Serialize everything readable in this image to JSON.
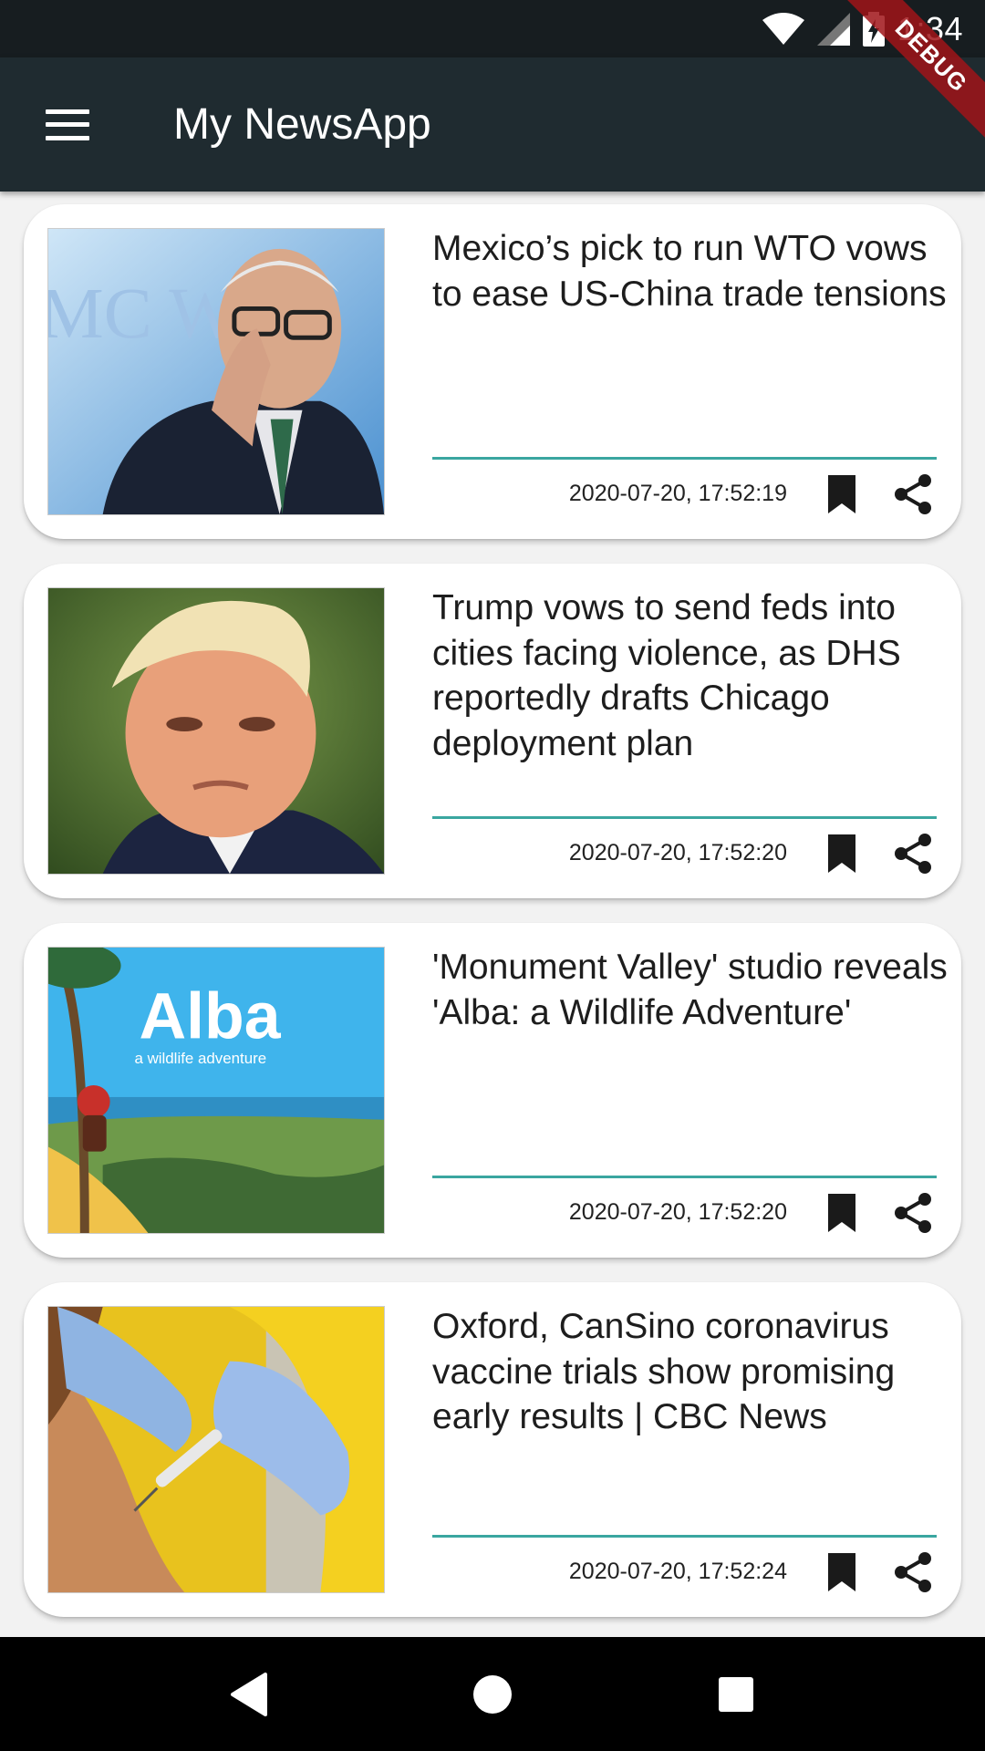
{
  "status_bar": {
    "time": "1:34",
    "debug_label": "DEBUG"
  },
  "app_bar": {
    "title": "My NewsApp",
    "menu_icon": "hamburger-menu-icon"
  },
  "articles": [
    {
      "headline": "Mexico’s pick to run WTO vows to ease US-China trade tensions",
      "timestamp": "2020-07-20, 17:52:19",
      "image": "wto-official-photo"
    },
    {
      "headline": "Trump vows to send feds into cities facing violence, as DHS reportedly drafts Chicago deployment plan",
      "timestamp": "2020-07-20, 17:52:20",
      "image": "trump-portrait-photo"
    },
    {
      "headline": "'Monument Valley' studio reveals 'Alba: a Wildlife Adventure'",
      "timestamp": "2020-07-20, 17:52:20",
      "image": "alba-game-art",
      "image_text": "Alba",
      "image_subtext": "a wildlife adventure"
    },
    {
      "headline": "Oxford, CanSino coronavirus vaccine trials show promising early results | CBC News",
      "timestamp": "2020-07-20, 17:52:24",
      "image": "vaccine-injection-photo"
    }
  ],
  "colors": {
    "app_bar": "#1f2b30",
    "status_bar": "#171d20",
    "divider": "#3aa6a0",
    "card": "#ffffff",
    "background": "#f2f2f2"
  }
}
